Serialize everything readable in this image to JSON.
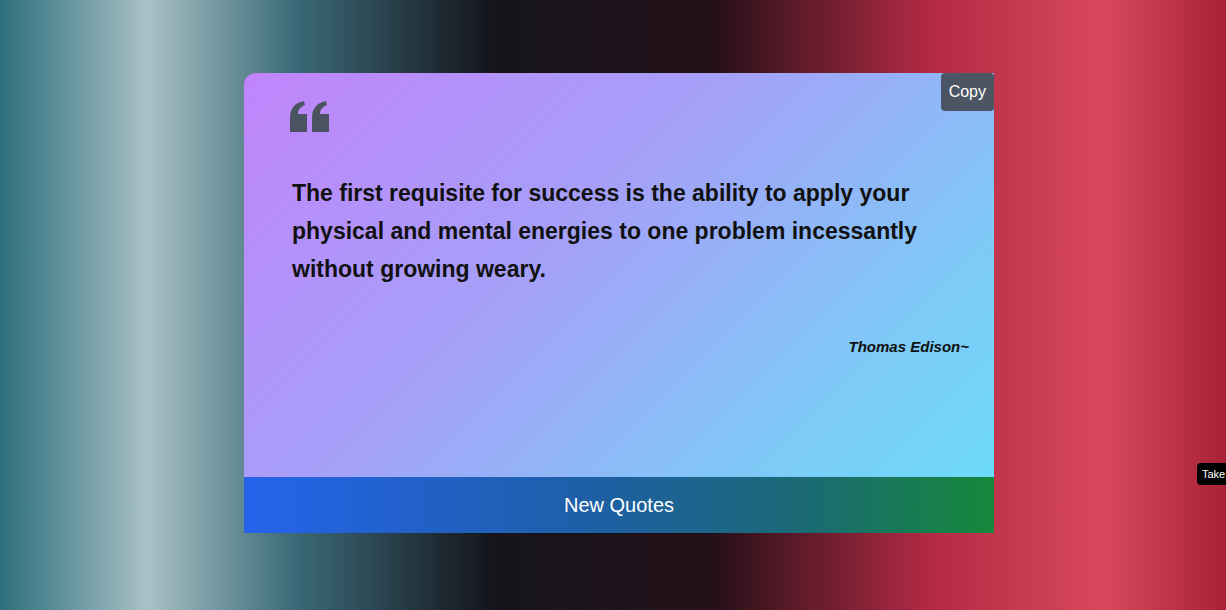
{
  "quote": {
    "text": "The first requisite for success is the ability to apply your physical and mental energies to one problem incessantly without growing weary.",
    "author": "Thomas Edison~"
  },
  "buttons": {
    "copy": "Copy",
    "new_quote": "New Quotes"
  },
  "side_tab": {
    "label": "Take"
  }
}
